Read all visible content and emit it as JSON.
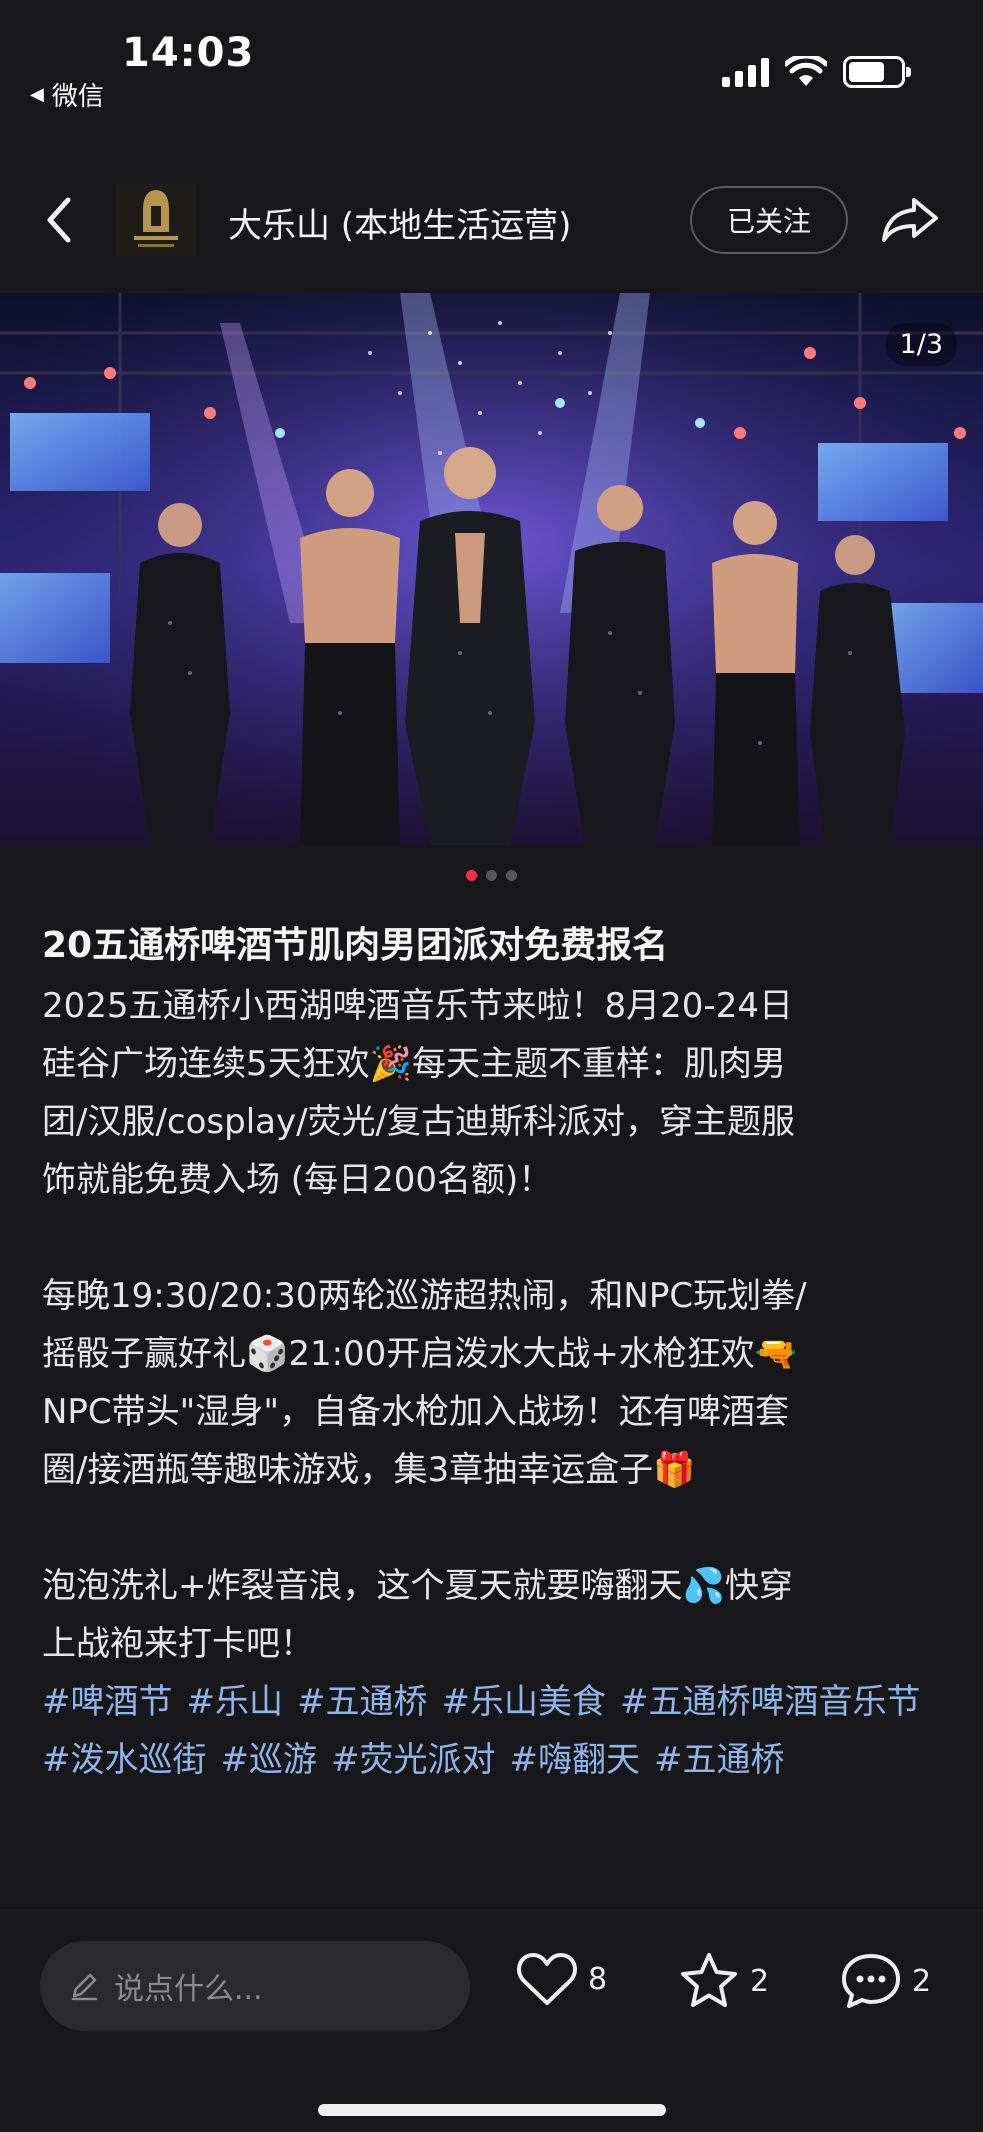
{
  "status_bar": {
    "time": "14:03",
    "back_app_label": "微信"
  },
  "header": {
    "account_name": "大乐山 (本地生活运营)",
    "follow_label": "已关注"
  },
  "media": {
    "page_indicator": "1/3",
    "total_images": 3,
    "current_image": 1
  },
  "post": {
    "title": "20五通桥啤酒节肌肉男团派对免费报名",
    "paragraphs": [
      "2025五通桥小西湖啤酒音乐节来啦！8月20-24日\n硅谷广场连续5天狂欢🎉每天主题不重样：肌肉男\n团/汉服/cosplay/荧光/复古迪斯科派对，穿主题服\n饰就能免费入场 (每日200名额)！",
      "每晚19:30/20:30两轮巡游超热闹，和NPC玩划拳/\n摇骰子赢好礼🎲21:00开启泼水大战+水枪狂欢🔫\nNPC带头\"湿身\"，自备水枪加入战场！还有啤酒套\n圈/接酒瓶等趣味游戏，集3章抽幸运盒子🎁",
      "泡泡洗礼+炸裂音浪，这个夏天就要嗨翻天💦快穿\n上战袍来打卡吧！"
    ],
    "tags": [
      "#啤酒节",
      "#乐山",
      "#五通桥",
      "#乐山美食",
      "#五通桥啤酒音乐节",
      "#泼水巡街",
      "#巡游",
      "#荧光派对",
      "#嗨翻天",
      "#五通桥"
    ]
  },
  "bottom_bar": {
    "comment_placeholder": "说点什么...",
    "likes": "8",
    "favorites": "2",
    "comments": "2"
  },
  "colors": {
    "background": "#17171a",
    "accent": "#ff2d4a",
    "tag": "#8eb4ec"
  }
}
